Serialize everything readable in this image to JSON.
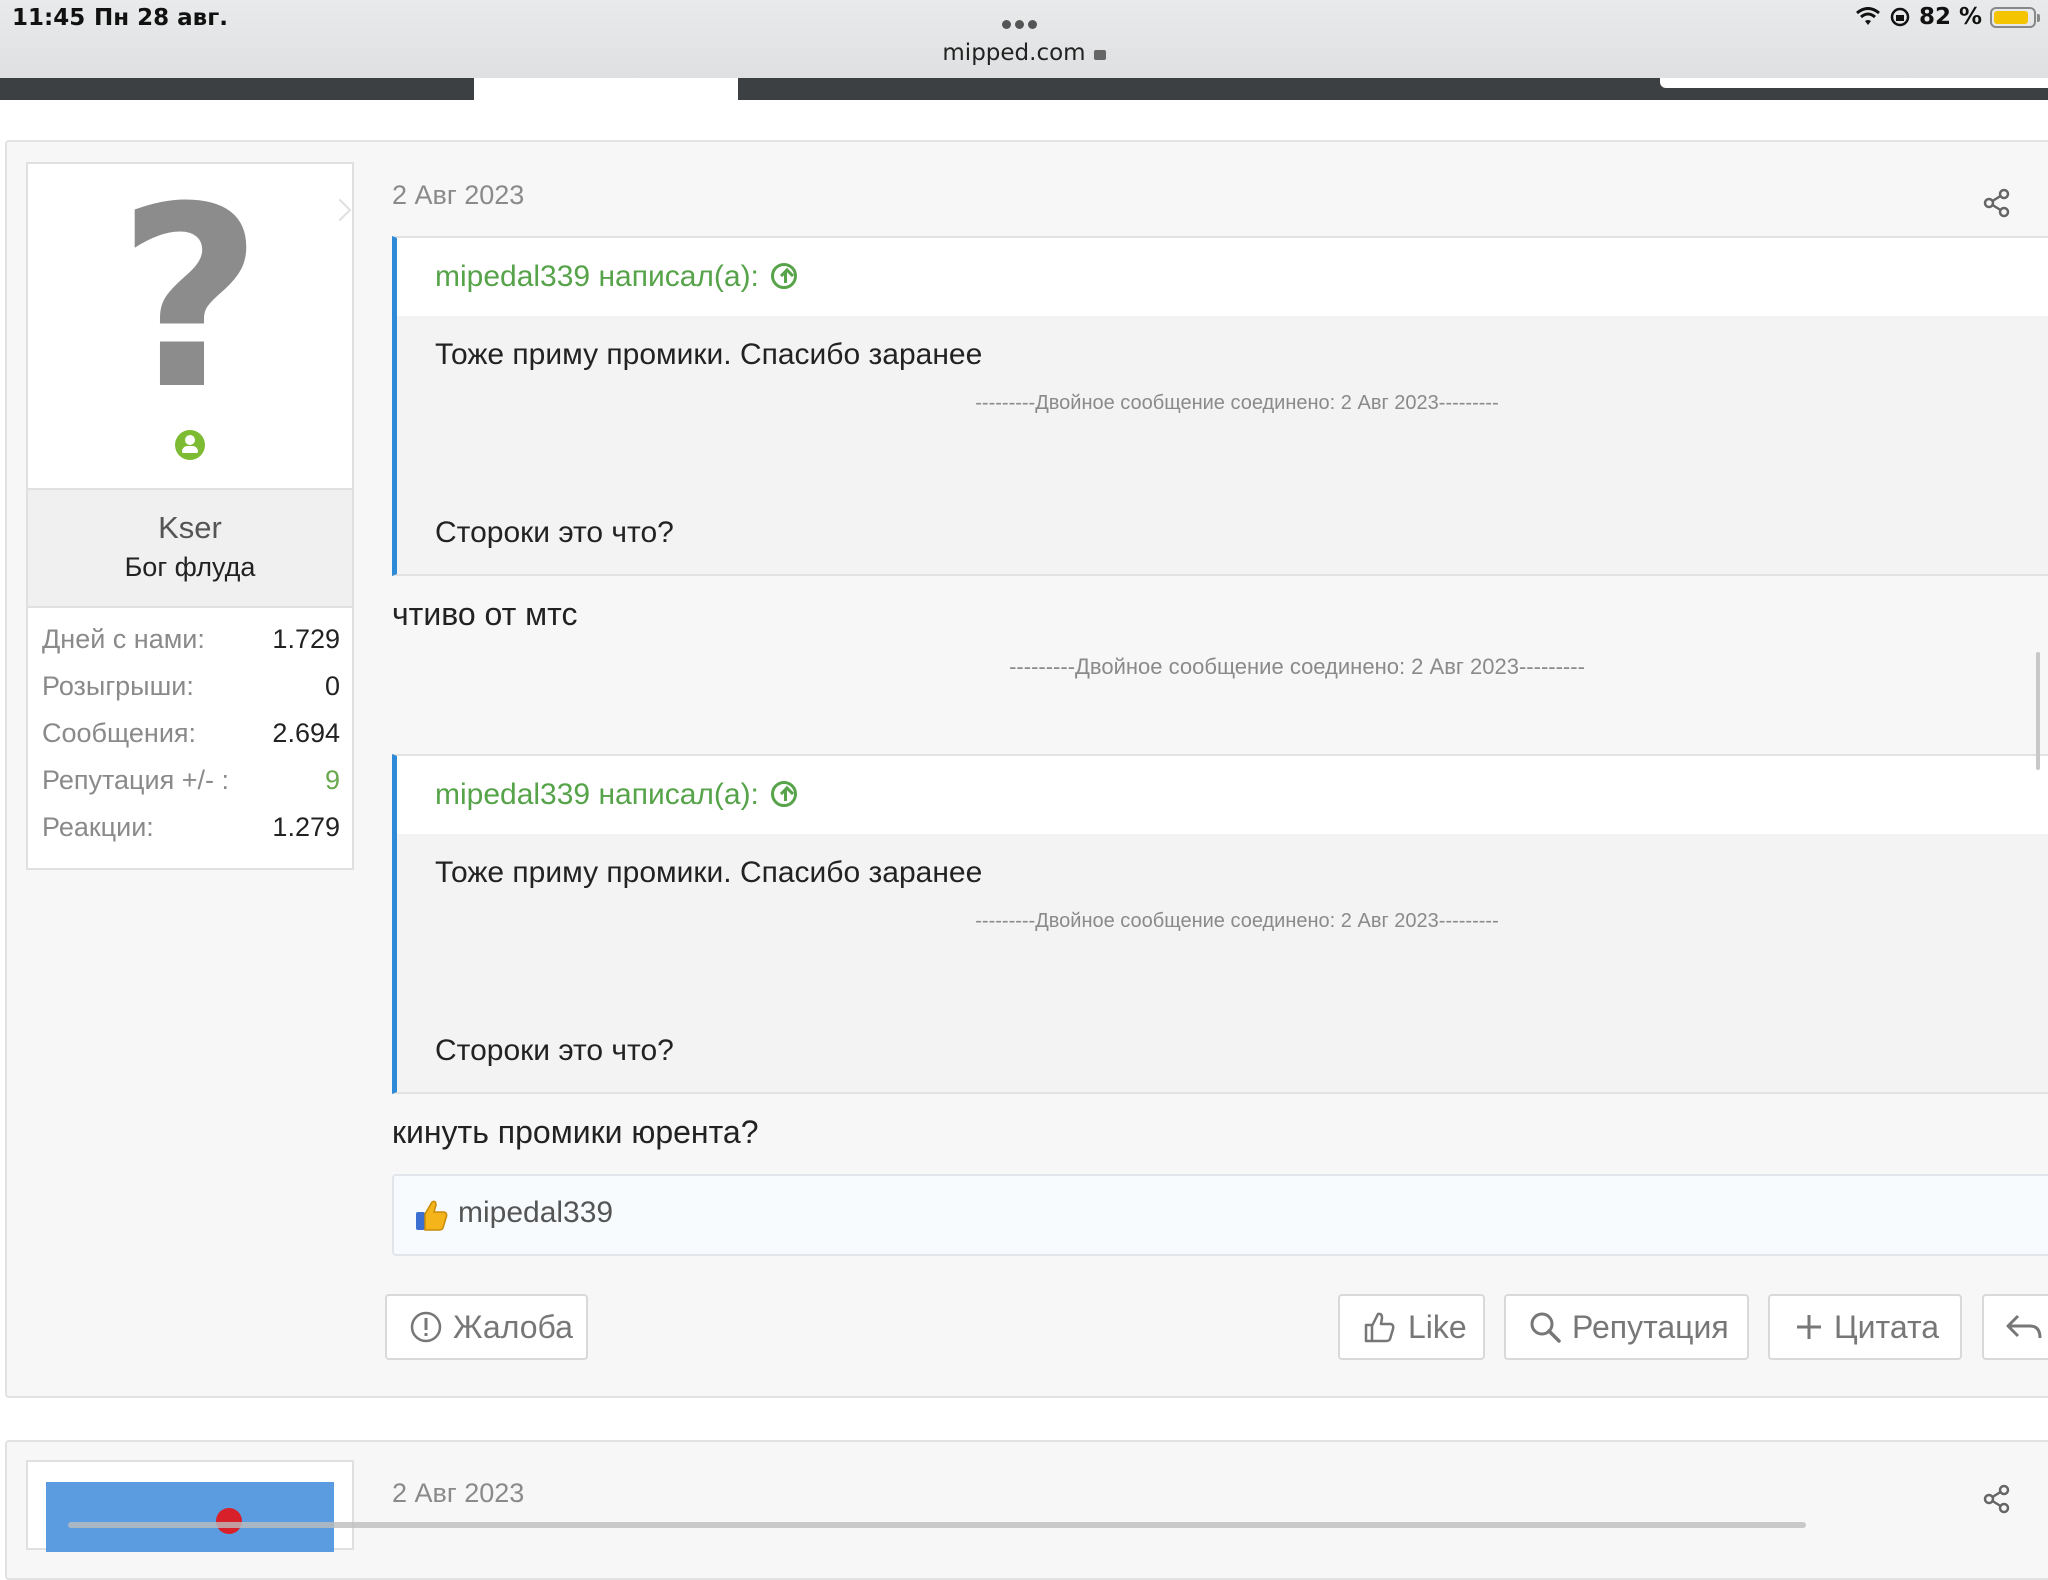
{
  "status_bar": {
    "time": "11:45",
    "date": "Пн 28 авг.",
    "url": "mipped.com",
    "battery": "82 %"
  },
  "post": {
    "date": "2 Авг 2023",
    "user": {
      "name": "Kser",
      "title": "Бог флуда",
      "avatar": "?",
      "stats": [
        {
          "label": "Дней с нами:",
          "value": "1.729"
        },
        {
          "label": "Розыгрыши:",
          "value": "0"
        },
        {
          "label": "Сообщения:",
          "value": "2.694"
        },
        {
          "label": "Репутация +/- :",
          "value": "9"
        },
        {
          "label": "Реакции:",
          "value": "1.279"
        }
      ]
    },
    "quote1": {
      "author": "mipedal339 написал(а):",
      "line1": "Тоже приму промики. Спасибо заранее",
      "merged": "---------Двойное сообщение соединено: 2 Авг 2023---------",
      "line2": "Стороки это что?"
    },
    "reply1": "чтиво от мтс",
    "merged_notice": "---------Двойное сообщение соединено: 2 Авг 2023---------",
    "quote2": {
      "author": "mipedal339 написал(а):",
      "line1": "Тоже приму промики. Спасибо заранее",
      "merged": "---------Двойное сообщение соединено: 2 Авг 2023---------",
      "line2": "Стороки это что?"
    },
    "reply2": "кинуть промики юрента?",
    "reaction_user": "mipedal339",
    "buttons": {
      "report": "Жалоба",
      "like": "Like",
      "reputation": "Репутация",
      "quote": "Цитата"
    }
  },
  "post2": {
    "date": "2 Авг 2023"
  },
  "colors": {
    "accent_green": "#56a34a",
    "quote_border": "#2d8ad6",
    "online": "#7dbb33"
  }
}
